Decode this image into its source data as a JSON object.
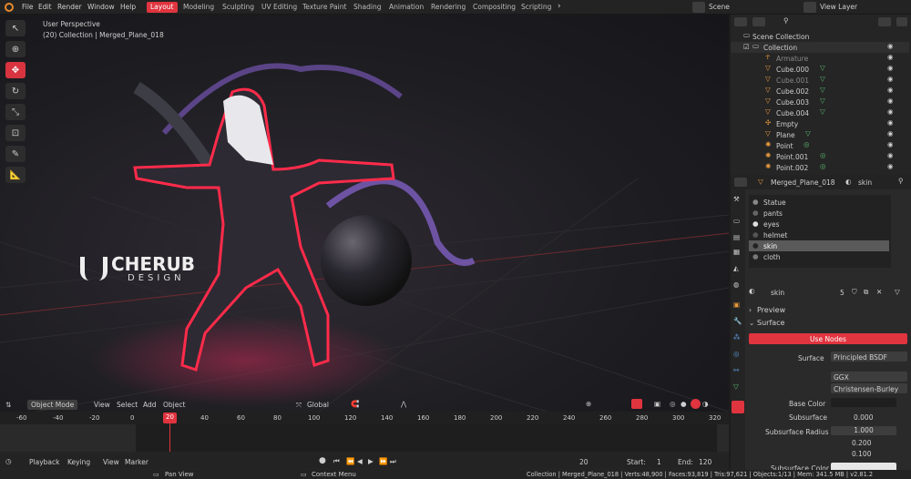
{
  "menu": [
    "File",
    "Edit",
    "Render",
    "Window",
    "Help"
  ],
  "workspaces": [
    {
      "label": "Layout",
      "active": true
    },
    {
      "label": "Modeling"
    },
    {
      "label": "Sculpting"
    },
    {
      "label": "UV Editing"
    },
    {
      "label": "Texture Paint"
    },
    {
      "label": "Shading"
    },
    {
      "label": "Animation"
    },
    {
      "label": "Rendering"
    },
    {
      "label": "Compositing"
    },
    {
      "label": "Scripting"
    }
  ],
  "header_right": {
    "scene": "Scene",
    "view_layer": "View Layer"
  },
  "viewport": {
    "perspective": "User Perspective",
    "collection": "(20) Collection | Merged_Plane_018",
    "logo_main": "CHERUB",
    "logo_sub": "DESIGN",
    "mode": "Object Mode",
    "menu": [
      "View",
      "Select",
      "Add",
      "Object"
    ],
    "orientation": "Global",
    "accent": "#e0343f"
  },
  "outliner": {
    "root": "Scene Collection",
    "collection": "Collection",
    "items": [
      "Armature",
      "Cube.000",
      "Cube.001",
      "Cube.002",
      "Cube.003",
      "Cube.004",
      "Empty",
      "Plane",
      "Point",
      "Point.001",
      "Point.002"
    ]
  },
  "properties": {
    "object": "Merged_Plane_018",
    "material": "skin",
    "materials": [
      "Statue",
      "pants",
      "eyes",
      "helmet",
      "skin",
      "cloth"
    ],
    "selected_material": "skin",
    "users": "5",
    "preview": "Preview",
    "surface_label": "Surface",
    "use_nodes": "Use Nodes",
    "surface_field": "Surface",
    "surface_value": "Principled BSDF",
    "distribution": "GGX",
    "subsurface_method": "Christensen-Burley",
    "base_color": "Base Color",
    "subsurface": "Subsurface",
    "subsurface_value": "0.000",
    "subsurface_radius": "Subsurface Radius",
    "radius": [
      "1.000",
      "0.200",
      "0.100"
    ],
    "subsurface_color": "Subsurface Color"
  },
  "timeline": {
    "ticks": [
      "-60",
      "-40",
      "-20",
      "0",
      "20",
      "40",
      "60",
      "80",
      "100",
      "120",
      "140",
      "160",
      "180",
      "200",
      "220",
      "240",
      "260",
      "280",
      "300",
      "320"
    ],
    "current_frame": "20",
    "start_label": "Start:",
    "start": "1",
    "end_label": "End:",
    "end": "120",
    "menu": [
      "Playback",
      "Keying",
      "View",
      "Marker"
    ]
  },
  "status": {
    "pan": "Pan View",
    "context": "Context Menu",
    "info": "Collection | Merged_Plane_018 | Verts:48,900 | Faces:93,819 | Tris:97,621 | Objects:1/13 | Mem: 341.5 MB | v2.81.2"
  }
}
